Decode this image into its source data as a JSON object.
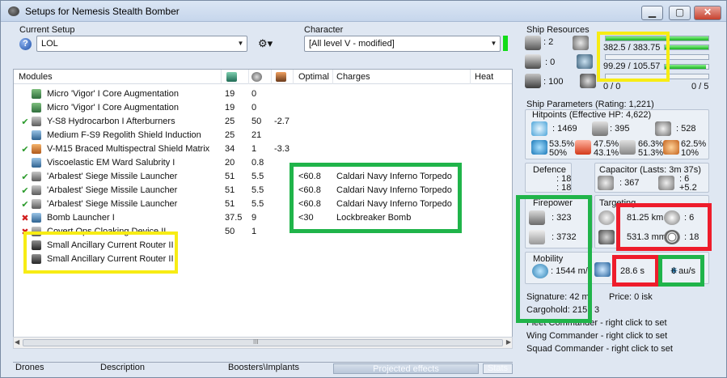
{
  "window": {
    "title": "Setups for Nemesis Stealth Bomber"
  },
  "current_setup": {
    "label": "Current Setup",
    "value": "LOL"
  },
  "character": {
    "label": "Character",
    "value": "[All level V - modified]"
  },
  "modules": {
    "headers": {
      "name": "Modules",
      "optimal": "Optimal",
      "charges": "Charges",
      "heat": "Heat"
    },
    "rows": [
      {
        "state": "",
        "name": "Micro 'Vigor' I Core Augmentation",
        "cpu": "19",
        "pg": "0",
        "cap": "",
        "optimal": "",
        "charge": ""
      },
      {
        "state": "",
        "name": "Micro 'Vigor' I Core Augmentation",
        "cpu": "19",
        "pg": "0",
        "cap": "",
        "optimal": "",
        "charge": ""
      },
      {
        "state": "✔",
        "name": "Y-S8 Hydrocarbon I Afterburners",
        "cpu": "25",
        "pg": "50",
        "cap": "-2.7",
        "optimal": "",
        "charge": ""
      },
      {
        "state": "",
        "name": "Medium F-S9 Regolith Shield Induction",
        "cpu": "25",
        "pg": "21",
        "cap": "",
        "optimal": "",
        "charge": ""
      },
      {
        "state": "✔",
        "name": "V-M15 Braced Multispectral Shield Matrix",
        "cpu": "34",
        "pg": "1",
        "cap": "-3.3",
        "optimal": "",
        "charge": ""
      },
      {
        "state": "",
        "name": "Viscoelastic EM Ward Salubrity I",
        "cpu": "20",
        "pg": "0.8",
        "cap": "",
        "optimal": "",
        "charge": ""
      },
      {
        "state": "✔",
        "name": "'Arbalest' Siege Missile Launcher",
        "cpu": "51",
        "pg": "5.5",
        "cap": "",
        "optimal": "<60.8",
        "charge": "Caldari Navy Inferno Torpedo"
      },
      {
        "state": "✔",
        "name": "'Arbalest' Siege Missile Launcher",
        "cpu": "51",
        "pg": "5.5",
        "cap": "",
        "optimal": "<60.8",
        "charge": "Caldari Navy Inferno Torpedo"
      },
      {
        "state": "✔",
        "name": "'Arbalest' Siege Missile Launcher",
        "cpu": "51",
        "pg": "5.5",
        "cap": "",
        "optimal": "<60.8",
        "charge": "Caldari Navy Inferno Torpedo"
      },
      {
        "state": "✖",
        "name": "Bomb Launcher I",
        "cpu": "37.5",
        "pg": "9",
        "cap": "",
        "optimal": "<30",
        "charge": "Lockbreaker Bomb"
      },
      {
        "state": "✖",
        "name": "Covert Ops Cloaking Device II",
        "cpu": "50",
        "pg": "1",
        "cap": "",
        "optimal": "",
        "charge": ""
      },
      {
        "state": "",
        "name": "Small Ancillary Current Router II",
        "cpu": "",
        "pg": "",
        "cap": "",
        "optimal": "",
        "charge": ""
      },
      {
        "state": "",
        "name": "Small Ancillary Current Router II",
        "cpu": "",
        "pg": "",
        "cap": "",
        "optimal": "",
        "charge": ""
      }
    ]
  },
  "scrollbar": {
    "grip": "III"
  },
  "bottom_tabs": {
    "drones": "Drones",
    "description": "Description",
    "boosters": "Boosters\\Implants",
    "projected": "Projected effects",
    "stats": "Stats",
    "projected_progress": 1.0
  },
  "ship_resources": {
    "title": "Ship Resources",
    "turret_slots": ": 2",
    "launcher_slots": ": 0",
    "drone_bay": ": 100",
    "cpu": "382.5 / 383.75",
    "powergrid": "99.29 / 105.57",
    "drone_bandwidth": "0 / 0",
    "drones_active": "0 / 5",
    "cpu_fill": 0.997,
    "pg_fill": 0.94,
    "bw_fill": 0.0
  },
  "ship_parameters": {
    "title": "Ship Parameters (Rating: 1,221)",
    "hitpoints_title": "Hitpoints (Effective HP: 4,622)",
    "shield_hp": ": 1469",
    "armor_hp": ": 395",
    "hull_hp": ": 528",
    "shield_res": {
      "em": "53.5%",
      "therm": "50%"
    },
    "armor_res": {
      "em": "47.5%",
      "therm": "43.1%"
    },
    "kin_res": {
      "shield": "66.3%",
      "armor": "51.3%"
    },
    "exp_res": {
      "shield": "62.5%",
      "armor": "10%"
    },
    "defence_title": "Defence",
    "defence_a": ": 18",
    "defence_b": ": 18",
    "capacitor_title": "Capacitor (Lasts: 3m 37s)",
    "capacitor_amount": ": 367",
    "capacitor_delta_a": ": 6",
    "capacitor_delta_b": "+5.2",
    "firepower_title": "Firepower",
    "dps": ": 323",
    "volley": ": 3732",
    "targeting_title": "Targeting",
    "target_range": "81.25 km",
    "max_targets": ": 6",
    "scan_res": "531.3 mm",
    "sensor_strength": ": 18",
    "mobility_title": "Mobility",
    "velocity": ": 1544 m/",
    "align_time": "28.6 s",
    "warp_speed": "6 au/s",
    "signature": "Signature: 42 m",
    "price": "Price: 0 isk",
    "cargohold": "Cargohold: 215",
    "cargohold_suffix": "3"
  },
  "commanders": {
    "fleet": "Fleet Commander - right click to set",
    "wing": "Wing Commander - right click to set",
    "squad": "Squad Commander - right click to set"
  },
  "colors": {
    "highlight_yellow": "#f7ec14",
    "highlight_green": "#20b44a",
    "highlight_red": "#ee1c2b",
    "resource_bar": "#19b31e"
  }
}
